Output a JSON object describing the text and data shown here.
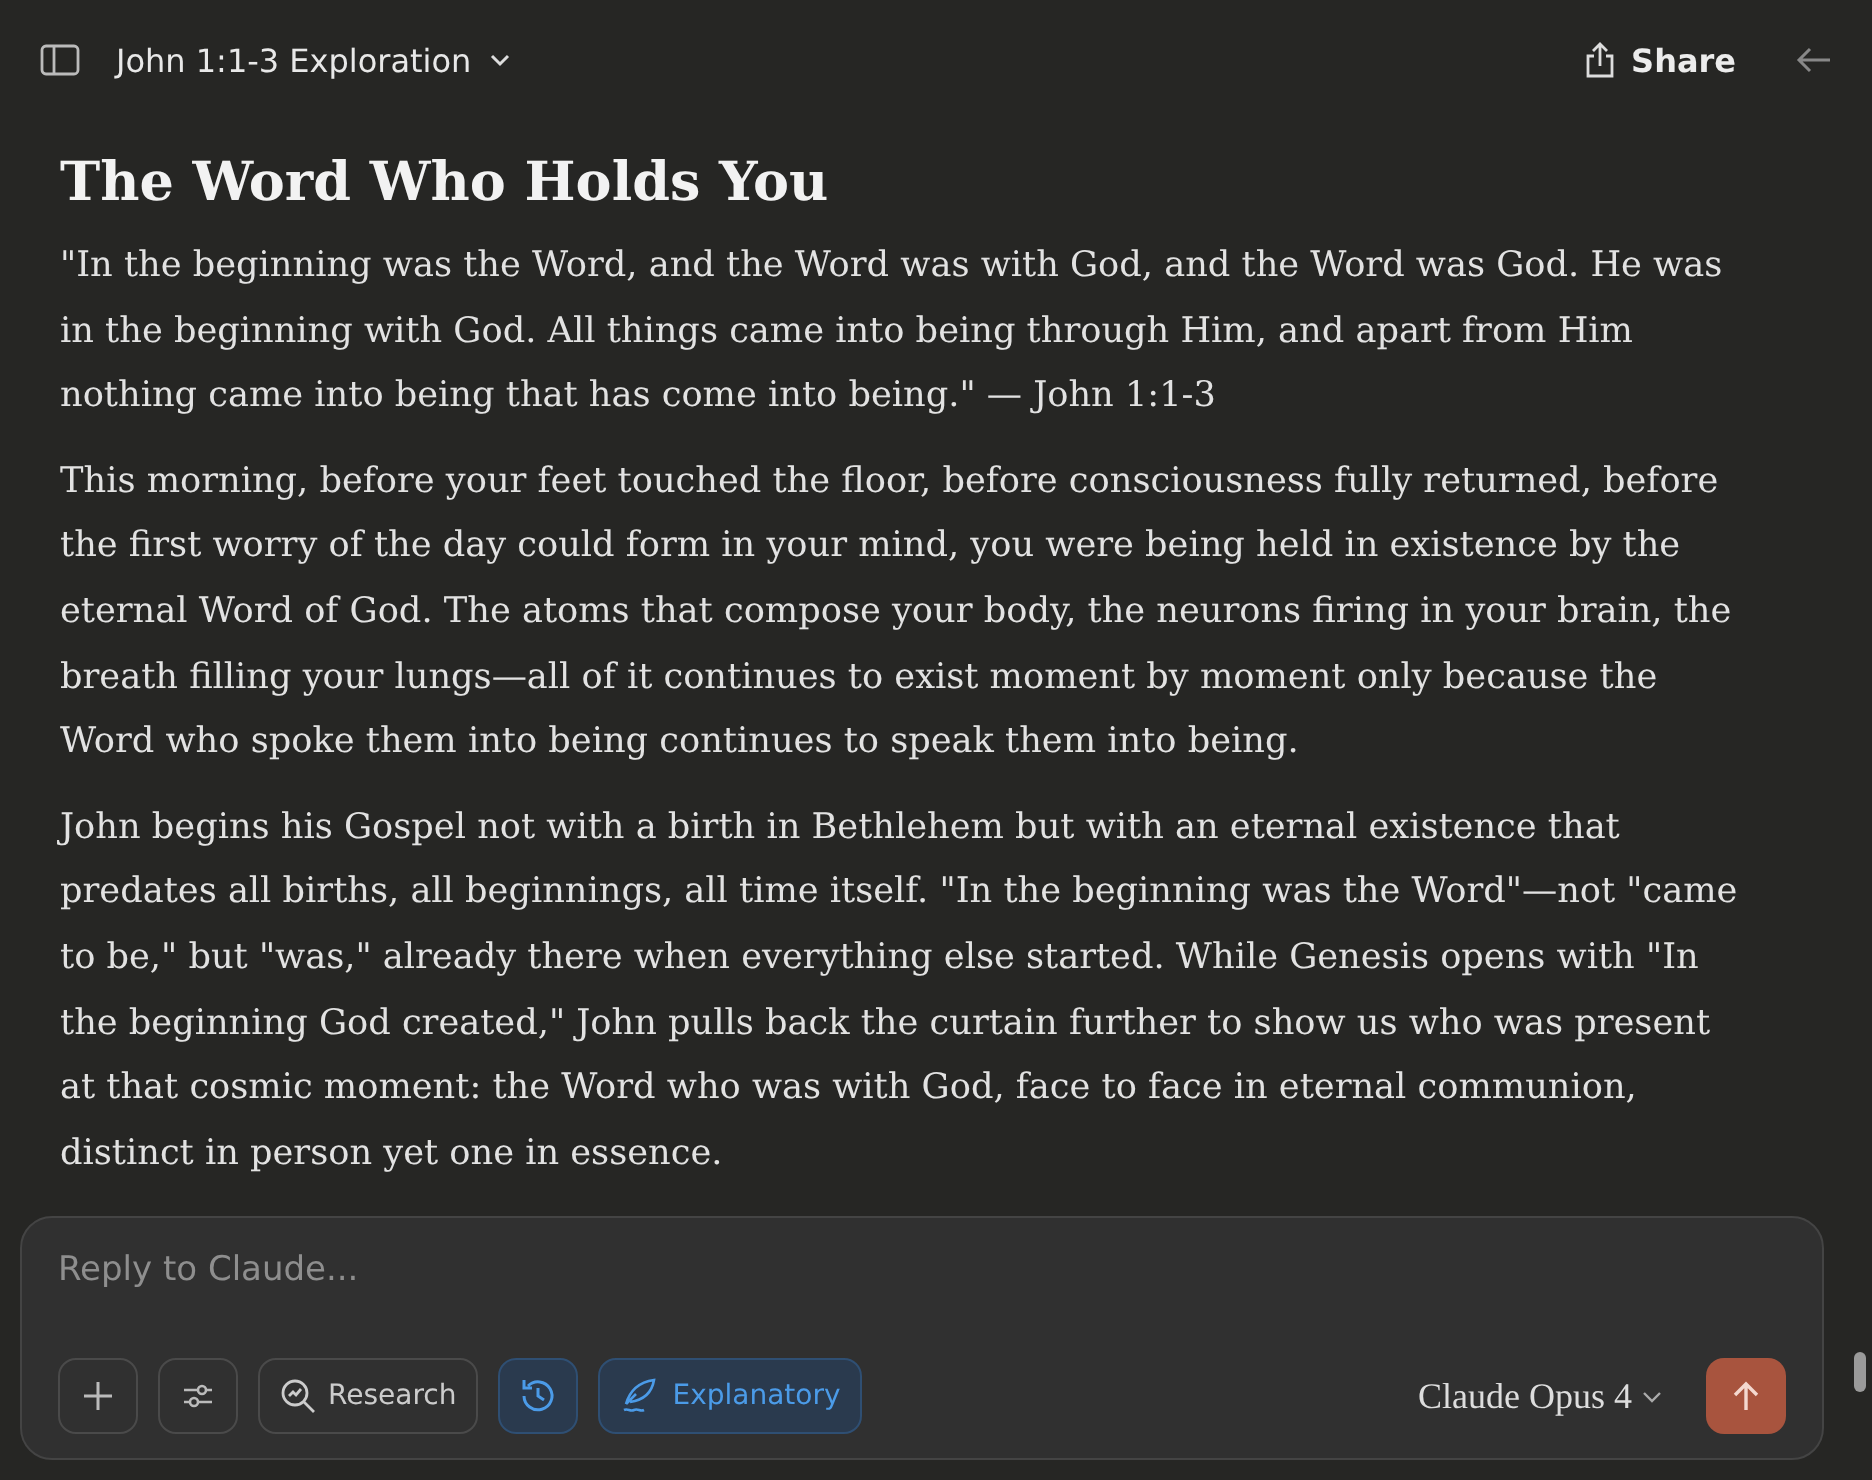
{
  "header": {
    "title": "John 1:1-3 Exploration",
    "share": "Share"
  },
  "article": {
    "heading": "The Word Who Holds You",
    "paragraphs": [
      "\"In the beginning was the Word, and the Word was with God, and the Word was God. He was in the beginning with God. All things came into being through Him, and apart from Him nothing came into being that has come into being.\" — John 1:1-3",
      "This morning, before your feet touched the floor, before consciousness fully returned, before the first worry of the day could form in your mind, you were being held in existence by the eternal Word of God. The atoms that compose your body, the neurons firing in your brain, the breath filling your lungs—all of it continues to exist moment by moment only because the Word who spoke them into being continues to speak them into being.",
      "John begins his Gospel not with a birth in Bethlehem but with an eternal existence that predates all births, all beginnings, all time itself. \"In the beginning was the Word\"—not \"came to be,\" but \"was,\" already there when everything else started. While Genesis opens with \"In the beginning God created,\" John pulls back the curtain further to show us who was present at that cosmic moment: the Word who was with God, face to face in eternal communion, distinct in person yet one in essence."
    ]
  },
  "composer": {
    "placeholder": "Reply to Claude...",
    "tools": [
      {
        "kind": "research",
        "label": "Research",
        "selected": false
      },
      {
        "kind": "history",
        "selected": true
      },
      {
        "kind": "style",
        "label": "Explanatory",
        "selected": true
      }
    ],
    "model": "Claude Opus 4"
  }
}
